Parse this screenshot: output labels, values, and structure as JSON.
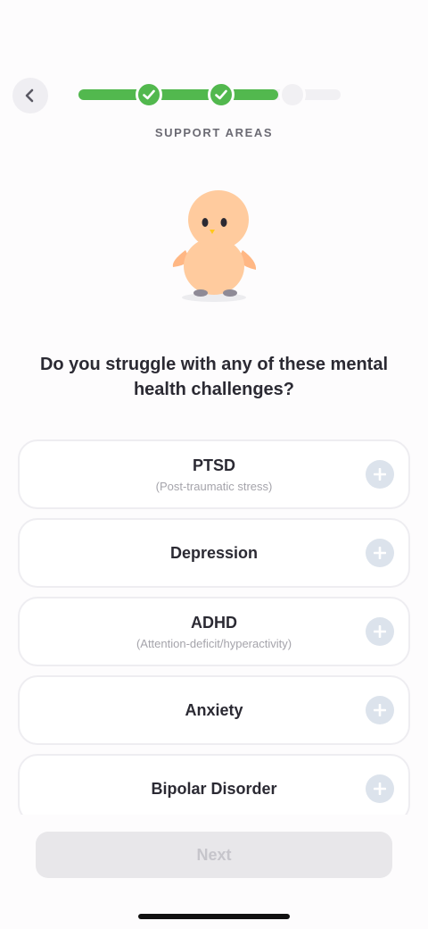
{
  "header": {
    "step_label": "SUPPORT AREAS",
    "progress": {
      "completed_steps": 2,
      "total_steps": 3
    }
  },
  "question": "Do you struggle with any of these mental health challenges?",
  "options": [
    {
      "title": "PTSD",
      "subtitle": "(Post-traumatic stress)"
    },
    {
      "title": "Depression",
      "subtitle": ""
    },
    {
      "title": "ADHD",
      "subtitle": "(Attention-deficit/hyperactivity)"
    },
    {
      "title": "Anxiety",
      "subtitle": ""
    },
    {
      "title": "Bipolar Disorder",
      "subtitle": ""
    }
  ],
  "footer": {
    "next_label": "Next"
  },
  "colors": {
    "progress_green": "#52b84e",
    "add_button": "#dce3ec",
    "mascot_body": "#ffcb9e"
  },
  "icons": {
    "back": "chevron-left-icon",
    "step_done": "checkmark-icon",
    "add": "plus-icon"
  }
}
